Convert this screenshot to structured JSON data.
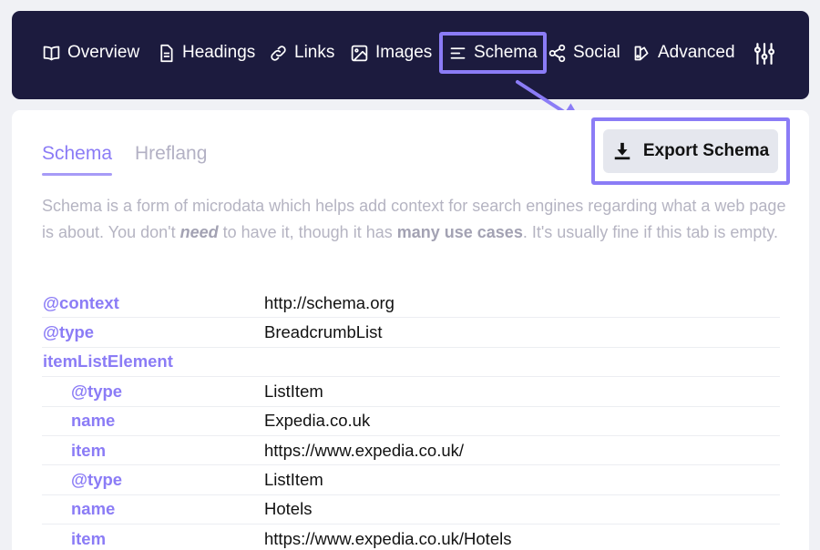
{
  "nav": {
    "items": [
      {
        "label": "Overview",
        "icon": "book-icon"
      },
      {
        "label": "Headings",
        "icon": "document-icon"
      },
      {
        "label": "Links",
        "icon": "link-icon"
      },
      {
        "label": "Images",
        "icon": "image-icon"
      },
      {
        "label": "Schema",
        "icon": "list-icon",
        "active": true
      },
      {
        "label": "Social",
        "icon": "share-icon"
      },
      {
        "label": "Advanced",
        "icon": "palette-icon"
      }
    ],
    "settings_icon": "sliders-icon"
  },
  "tabs": {
    "schema": "Schema",
    "hreflang": "Hreflang"
  },
  "export_button": {
    "label": "Export Schema",
    "icon": "download-icon"
  },
  "description": {
    "part1": "Schema is a form of microdata which helps add context for search engines regarding what a web page is about. You don't ",
    "emphasis": "need",
    "part2": " to have it, though it has ",
    "strong": "many use cases",
    "part3": ". It's usually fine if this tab is empty."
  },
  "schema_rows": [
    {
      "key": "@context",
      "value": "http://schema.org",
      "indent": false
    },
    {
      "key": "@type",
      "value": "BreadcrumbList",
      "indent": false
    },
    {
      "key": "itemListElement",
      "value": "",
      "indent": false
    },
    {
      "key": "@type",
      "value": "ListItem",
      "indent": true
    },
    {
      "key": "name",
      "value": "Expedia.co.uk",
      "indent": true
    },
    {
      "key": "item",
      "value": "https://www.expedia.co.uk/",
      "indent": true
    },
    {
      "key": "@type",
      "value": "ListItem",
      "indent": true
    },
    {
      "key": "name",
      "value": "Hotels",
      "indent": true
    },
    {
      "key": "item",
      "value": "https://www.expedia.co.uk/Hotels",
      "indent": true
    }
  ],
  "colors": {
    "navbar_bg": "#1c1b3e",
    "accent": "#8b7cf6",
    "highlight_border": "#8b7cf6",
    "page_bg": "#f0f1f5"
  }
}
